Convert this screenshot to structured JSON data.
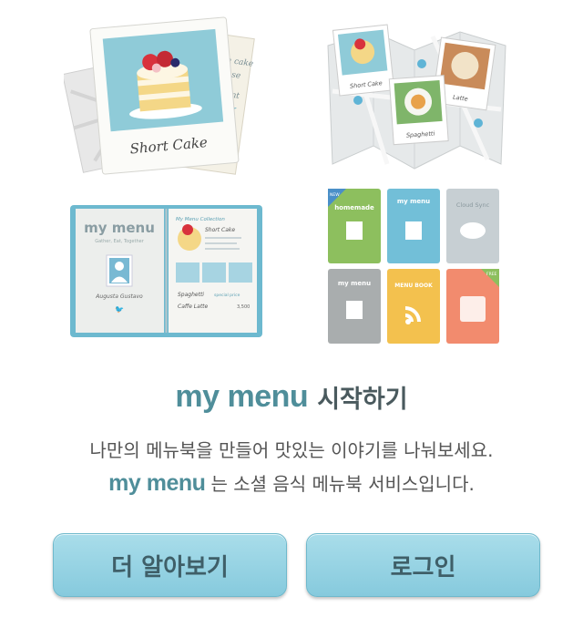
{
  "illustrations": {
    "polaroid_caption": "Short Cake",
    "polaroid_note_lines": [
      "cream cake",
      "by house",
      "Excellent"
    ],
    "map_captions": [
      "Short Cake",
      "Spaghetti",
      "Latte"
    ],
    "book_brand": "my menu",
    "book_subtitle": "Gather, Eat, Together",
    "book_collection": "My Menu Collection",
    "book_item_title": "Short Cake",
    "book_author": "Augusta Gustavo",
    "book_list": [
      {
        "name": "Spaghetti",
        "tag": "special price"
      },
      {
        "name": "Caffe Latte",
        "price": "3,500"
      }
    ],
    "shelf_books": [
      {
        "label": "homemade",
        "color": "#8dbf5e",
        "badge": "NEW"
      },
      {
        "label": "my menu",
        "color": "#72bfd8"
      },
      {
        "label": "Cloud Sync",
        "color": "#c7cfd3"
      },
      {
        "label": "my menu",
        "color": "#a9adae"
      },
      {
        "label": "MENU BOOK",
        "color": "#f3c14e"
      },
      {
        "label": "",
        "color": "#f28b6e",
        "badge": "FREE"
      }
    ]
  },
  "title": {
    "brand": "my menu",
    "text": "시작하기"
  },
  "desc": {
    "line1": "나만의 메뉴북을 만들어 맛있는 이야기를 나눠보세요.",
    "line2_brand": "my menu",
    "line2_text": "는 소셜 음식 메뉴북 서비스입니다."
  },
  "buttons": {
    "more": "더 알아보기",
    "login": "로그인"
  }
}
